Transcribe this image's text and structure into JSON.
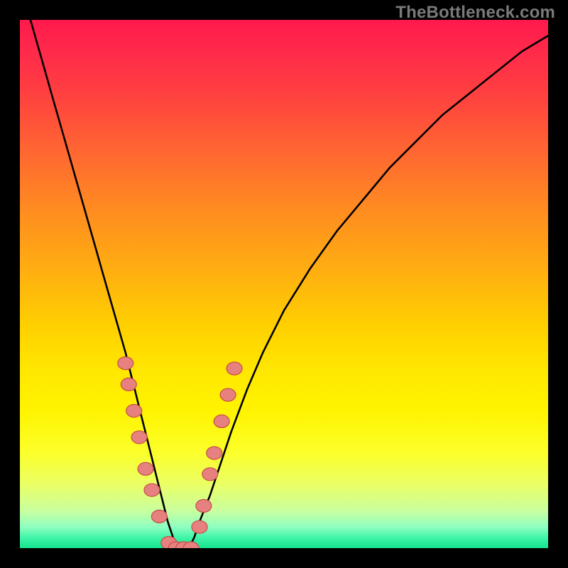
{
  "watermark": "TheBottleneck.com",
  "chart_data": {
    "type": "line",
    "title": "",
    "xlabel": "",
    "ylabel": "",
    "xlim": [
      0,
      100
    ],
    "ylim": [
      0,
      100
    ],
    "series": [
      {
        "name": "curve",
        "x": [
          2,
          4,
          6,
          8,
          10,
          12,
          14,
          16,
          18,
          20,
          21,
          22,
          23,
          24,
          25,
          26,
          27,
          28,
          29,
          30,
          31,
          32,
          33,
          34,
          36,
          38,
          40,
          43,
          46,
          50,
          55,
          60,
          65,
          70,
          75,
          80,
          85,
          90,
          95,
          100
        ],
        "y": [
          100,
          93,
          86,
          79,
          72,
          65,
          58,
          51,
          44,
          37,
          33,
          29,
          25,
          21,
          17,
          13,
          9,
          5,
          2,
          0,
          0,
          0,
          2,
          5,
          10,
          16,
          22,
          30,
          37,
          45,
          53,
          60,
          66,
          72,
          77,
          82,
          86,
          90,
          94,
          97
        ]
      }
    ],
    "markers": [
      {
        "x": 20.0,
        "y": 35
      },
      {
        "x": 20.6,
        "y": 31
      },
      {
        "x": 21.6,
        "y": 26
      },
      {
        "x": 22.6,
        "y": 21
      },
      {
        "x": 23.8,
        "y": 15
      },
      {
        "x": 25.0,
        "y": 11
      },
      {
        "x": 26.4,
        "y": 6
      },
      {
        "x": 28.2,
        "y": 1
      },
      {
        "x": 29.6,
        "y": 0
      },
      {
        "x": 31.0,
        "y": 0
      },
      {
        "x": 32.4,
        "y": 0
      },
      {
        "x": 34.0,
        "y": 4
      },
      {
        "x": 34.8,
        "y": 8
      },
      {
        "x": 36.0,
        "y": 14
      },
      {
        "x": 36.8,
        "y": 18
      },
      {
        "x": 38.2,
        "y": 24
      },
      {
        "x": 39.4,
        "y": 29
      },
      {
        "x": 40.6,
        "y": 34
      }
    ],
    "marker_group_name": "scatter-points",
    "curve_color": "#000000",
    "marker_fill": "#E6817F",
    "marker_stroke": "#C84C4A"
  }
}
